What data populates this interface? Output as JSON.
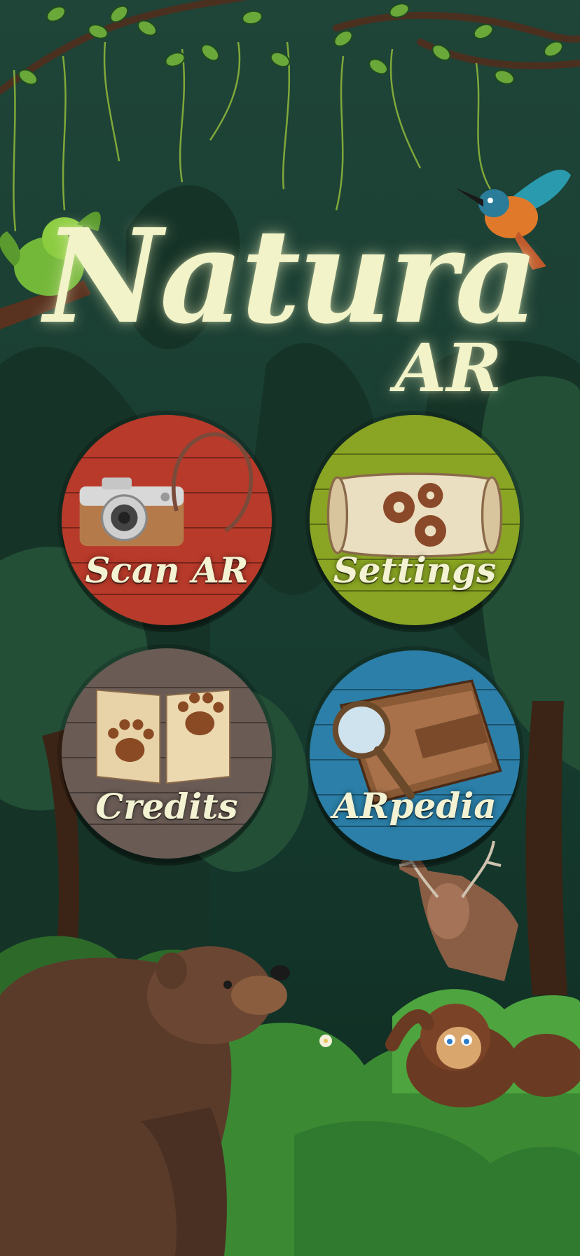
{
  "app": {
    "title_main": "Natura",
    "title_sub": "AR"
  },
  "menu": [
    {
      "id": "scan-ar",
      "label": "Scan AR",
      "icon": "camera-icon",
      "color": "#b83a2a"
    },
    {
      "id": "settings",
      "label": "Settings",
      "icon": "gears-scroll-icon",
      "color": "#8aa523"
    },
    {
      "id": "credits",
      "label": "Credits",
      "icon": "paw-book-icon",
      "color": "#6a5b55"
    },
    {
      "id": "arpedia",
      "label": "ARpedia",
      "icon": "journal-magnifier-icon",
      "color": "#2b7fa8"
    }
  ],
  "colors": {
    "background": "#1d3f34",
    "title": "#f2f3c8",
    "foliage_dark": "#123227",
    "foliage_mid": "#2e6b2e",
    "foliage_light": "#4c9a3a"
  }
}
